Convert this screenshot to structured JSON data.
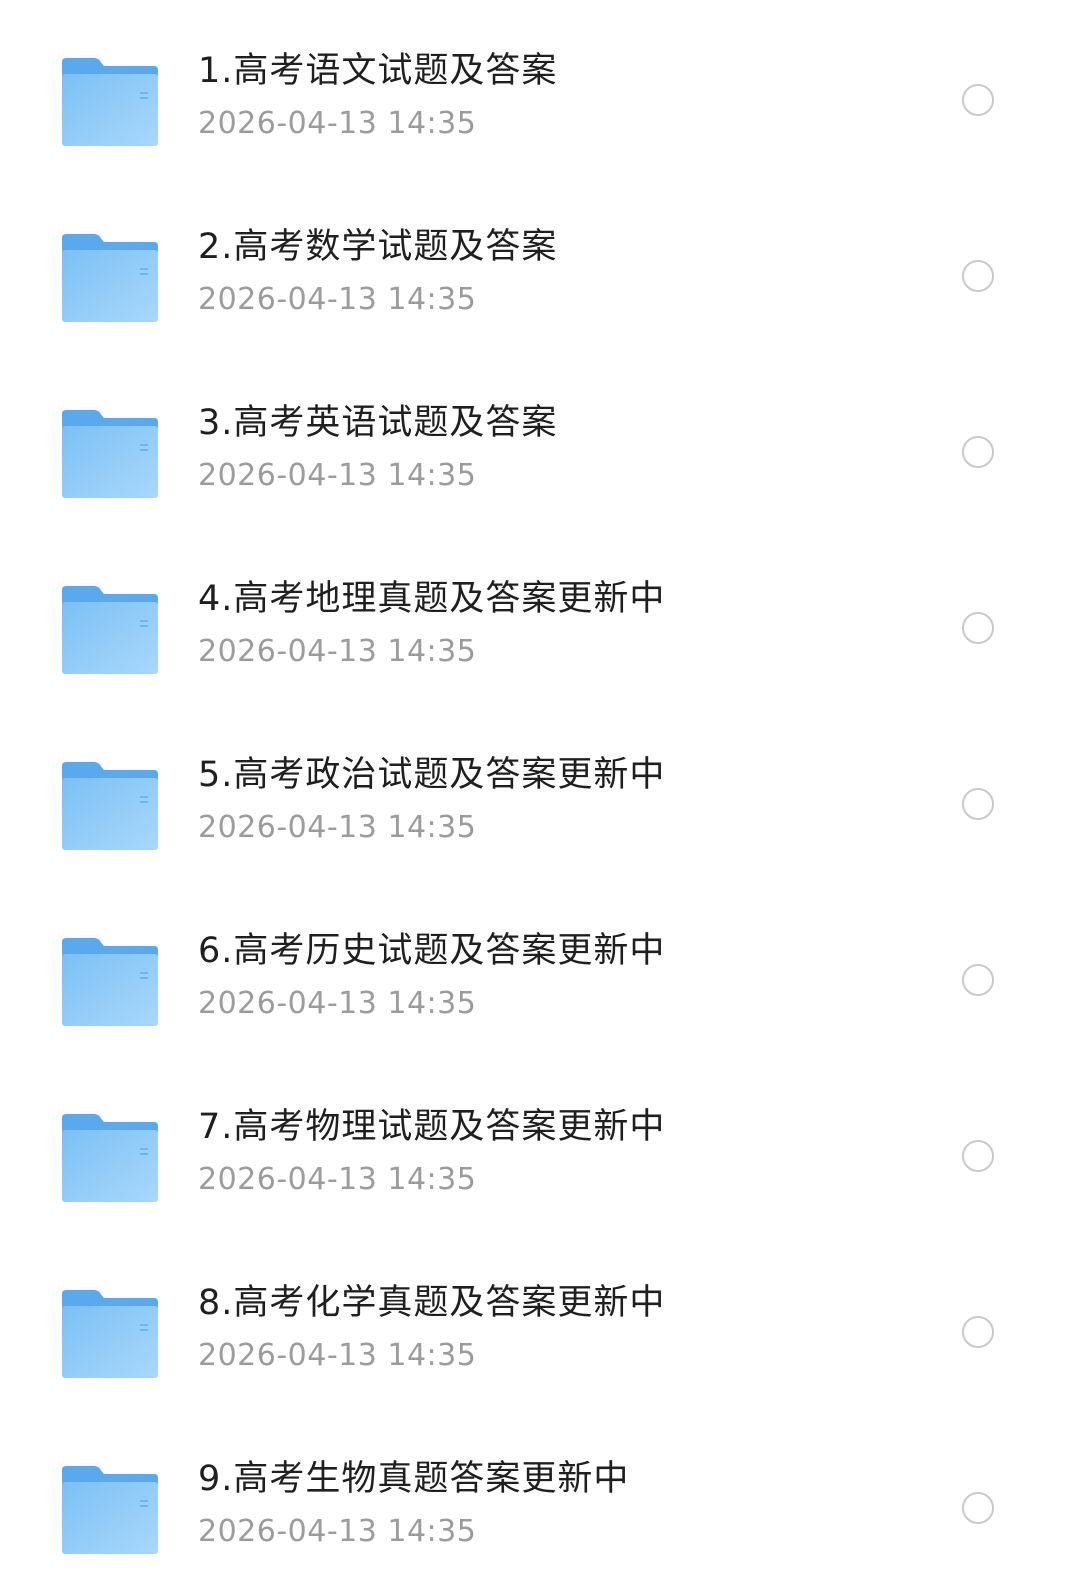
{
  "files": [
    {
      "name": "1.高考语文试题及答案",
      "date": "2026-04-13 14:35"
    },
    {
      "name": "2.高考数学试题及答案",
      "date": "2026-04-13 14:35"
    },
    {
      "name": "3.高考英语试题及答案",
      "date": "2026-04-13 14:35"
    },
    {
      "name": "4.高考地理真题及答案更新中",
      "date": "2026-04-13 14:35"
    },
    {
      "name": "5.高考政治试题及答案更新中",
      "date": "2026-04-13 14:35"
    },
    {
      "name": "6.高考历史试题及答案更新中",
      "date": "2026-04-13 14:35"
    },
    {
      "name": "7.高考物理试题及答案更新中",
      "date": "2026-04-13 14:35"
    },
    {
      "name": "8.高考化学真题及答案更新中",
      "date": "2026-04-13 14:35"
    },
    {
      "name": "9.高考生物真题答案更新中",
      "date": "2026-04-13 14:35"
    }
  ],
  "icon": "folder-icon",
  "colors": {
    "folder_light": "#9fd2f8",
    "folder_dark": "#5daef0",
    "name_text": "#1f1f1f",
    "date_text": "#9c9c9c",
    "radio_border": "#c9c9c9"
  }
}
